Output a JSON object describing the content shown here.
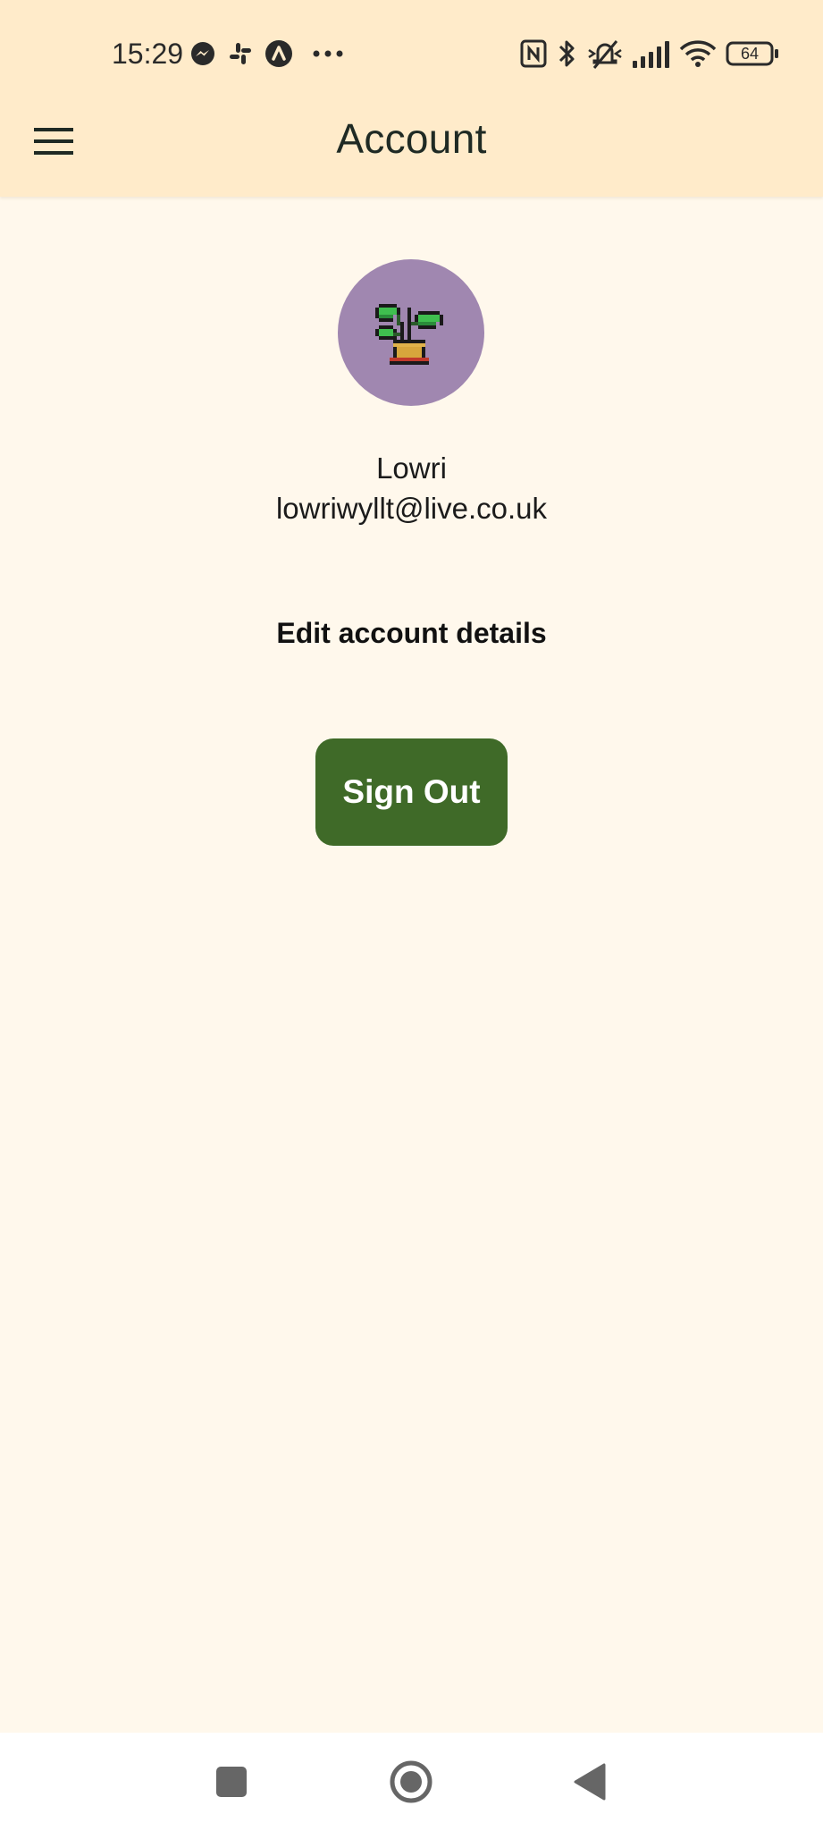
{
  "status_bar": {
    "time": "15:29",
    "battery_level": "64",
    "notification_icons": [
      "messenger-icon",
      "slack-icon",
      "app-notification-icon",
      "more-dots-icon"
    ],
    "system_icons": [
      "nfc-icon",
      "bluetooth-icon",
      "silent-icon",
      "signal-icon",
      "wifi-icon",
      "battery-icon"
    ]
  },
  "app_bar": {
    "title": "Account",
    "menu_icon": "hamburger-menu-icon"
  },
  "profile": {
    "avatar_icon": "potted-plant-icon",
    "avatar_color": "#a087b0",
    "name": "Lowri",
    "email": "lowriwyllt@live.co.uk"
  },
  "actions": {
    "edit_label": "Edit account details",
    "sign_out_label": "Sign Out"
  },
  "colors": {
    "header_bg": "#ffebca",
    "page_bg": "#fff8ec",
    "button_green": "#3f6a28"
  },
  "nav_bar": {
    "buttons": [
      "recents-square-icon",
      "home-circle-icon",
      "back-triangle-icon"
    ]
  }
}
